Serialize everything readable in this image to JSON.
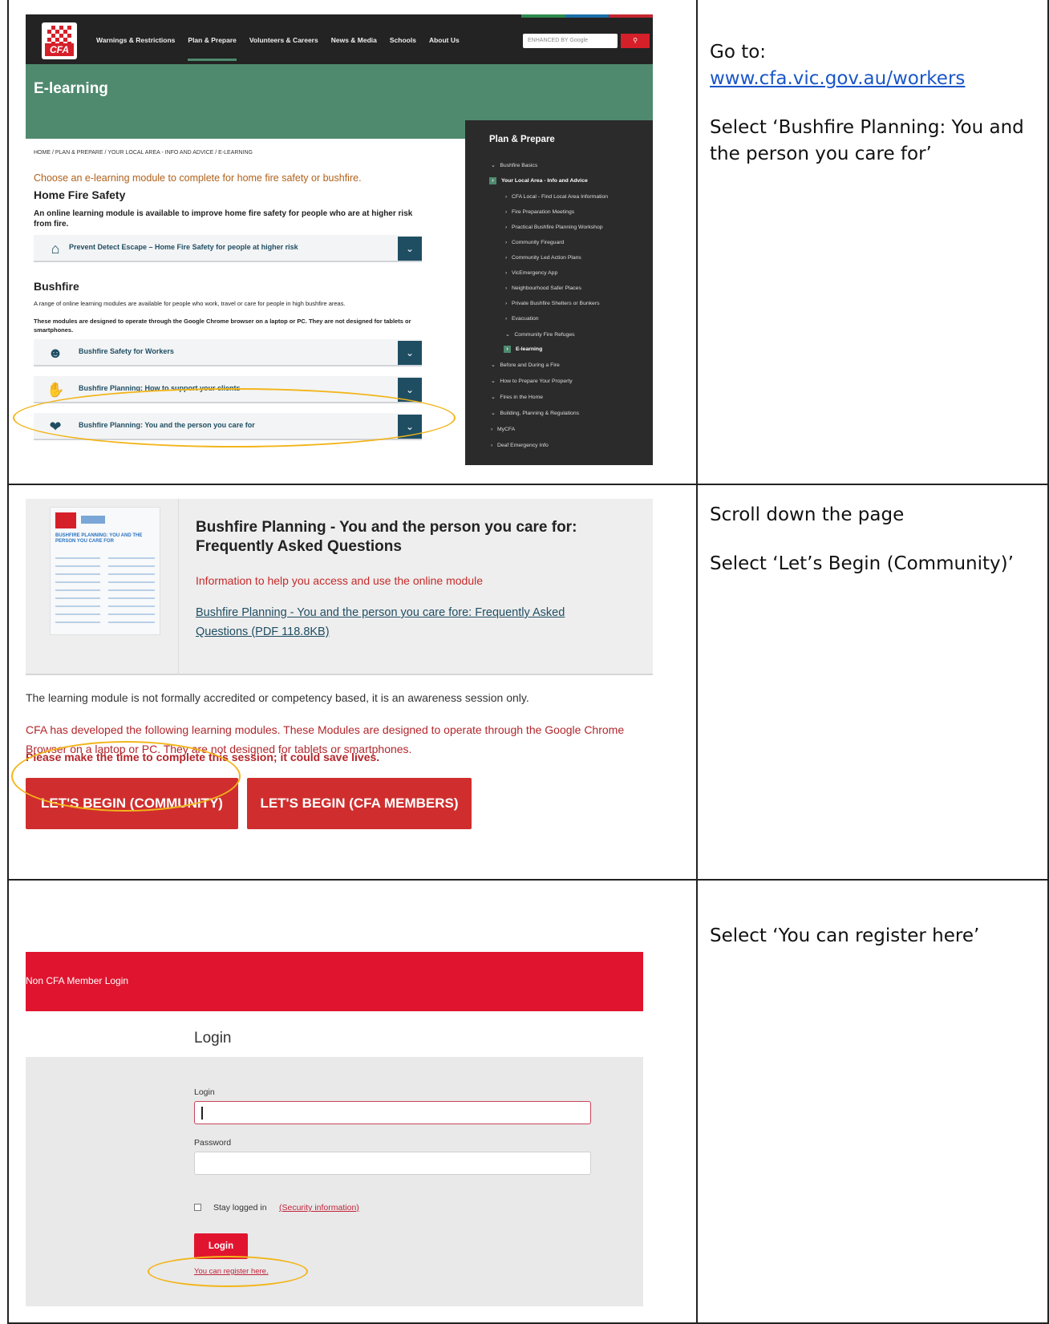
{
  "instructions": [
    {
      "lines": [
        "Go to:"
      ],
      "link": "www.cfa.vic.gov.au/workers",
      "after": "Select ‘Bushfire Planning: You and the person you care for’"
    },
    {
      "lines": [
        "Scroll down the page"
      ],
      "after": "Select ‘Let’s Begin (Community)’"
    },
    {
      "lines": [
        "Select ‘You can register here’"
      ]
    }
  ],
  "panel1": {
    "logo_text": "CFA",
    "nav": [
      "Warnings & Restrictions",
      "Plan & Prepare",
      "Volunteers & Careers",
      "News & Media",
      "Schools",
      "About Us"
    ],
    "search_placeholder": "ENHANCED BY Google",
    "top_colors": [
      "#2d8a4e",
      "#1b6fa8",
      "#c4262e"
    ],
    "hero_title": "E-learning",
    "breadcrumb": "HOME / PLAN & PREPARE / YOUR LOCAL AREA - INFO AND ADVICE / E-LEARNING",
    "intro": "Choose an e-learning module to complete for home fire safety or bushfire.",
    "home_fire_heading": "Home Fire Safety",
    "home_fire_text": "An online learning module is available to improve home fire safety for people who are at higher risk from fire.",
    "home_fire_accordion": "Prevent Detect Escape – Home Fire Safety for people at higher risk",
    "bushfire_heading": "Bushfire",
    "bushfire_text": "A range of online learning modules are available for people who work, travel or care for people in high bushfire areas.",
    "bushfire_note": "These modules are designed to operate through the Google Chrome browser on a laptop or PC. They are not designed for tablets or smartphones.",
    "bushfire_accordions": [
      "Bushfire Safety for Workers",
      "Bushfire Planning: How to support your clients",
      "Bushfire Planning: You and the person you care for"
    ],
    "sidebar_title": "Plan & Prepare",
    "sidebar_items": [
      "Bushfire Basics",
      "Your Local Area - Info and Advice",
      "CFA Local - Find Local Area Information",
      "Fire Preparation Meetings",
      "Practical Bushfire Planning Workshop",
      "Community Fireguard",
      "Community Led Action Plans",
      "VicEmergency App",
      "Neighbourhood Safer Places",
      "Private Bushfire Shelters or Bunkers",
      "Evacuation",
      "Community Fire Refuges",
      "E-learning",
      "Before and During a Fire",
      "How to Prepare Your Property",
      "Fires in the Home",
      "Building, Planning & Regulations",
      "MyCFA",
      "Deaf Emergency Info"
    ]
  },
  "panel2": {
    "thumb_title": "BUSHFIRE PLANNING: YOU AND THE PERSON YOU CARE FOR",
    "title": "Bushfire Planning - You and the person you care for: Frequently Asked Questions",
    "info": "Information to help you access and use the online module",
    "link": "Bushfire Planning - You and the person you care fore: Frequently Asked Questions (PDF 118.8KB)",
    "para1": "The learning module is not formally accredited or competency based, it is an awareness session only.",
    "para2": "CFA has developed the following learning modules. These Modules are designed to operate through the Google Chrome Browser on a laptop or PC. They are not designed for tablets or smartphones.",
    "para3": "Please make the time to complete this session; it could save lives.",
    "btn_community": "LET'S BEGIN (COMMUNITY)",
    "btn_members": "LET'S BEGIN (CFA MEMBERS)"
  },
  "panel3": {
    "bar_text": "Non CFA Member Login",
    "heading": "Login",
    "login_label": "Login",
    "password_label": "Password",
    "stay_logged": "Stay logged in",
    "security": "(Security information)",
    "login_button": "Login",
    "register": "You can register here."
  },
  "colors": {
    "highlight": "#f2b51a",
    "cfa_red": "#d5202a",
    "cfa_green": "#4f8a6f",
    "teal": "#1f4e63"
  }
}
